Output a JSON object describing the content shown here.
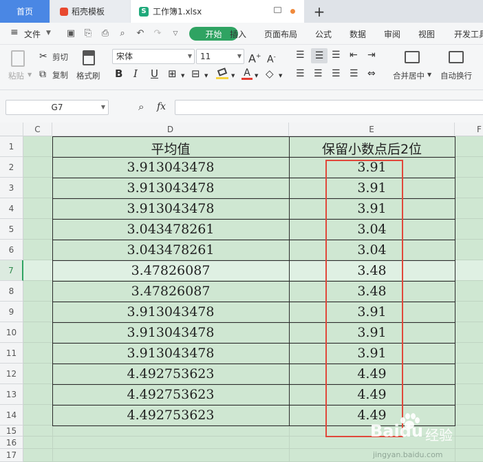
{
  "tabs": {
    "home": "首页",
    "template": "稻壳模板",
    "document": "工作簿1.xlsx",
    "doc_icon": "S"
  },
  "menu": {
    "file": "文件",
    "active": "开始",
    "items": [
      "插入",
      "页面布局",
      "公式",
      "数据",
      "审阅",
      "视图",
      "开发工具"
    ]
  },
  "ribbon": {
    "paste": "粘贴",
    "cut": "剪切",
    "copy": "复制",
    "format_painter": "格式刷",
    "font_name": "宋体",
    "font_size": "11",
    "bold": "B",
    "italic": "I",
    "underline": "U",
    "merge_center": "合并居中",
    "wrap_text": "自动换行"
  },
  "formula_bar": {
    "cell_ref": "G7",
    "fx": "fx",
    "formula": ""
  },
  "sheet": {
    "columns": [
      "C",
      "D",
      "E",
      "F"
    ],
    "rows": [
      "1",
      "2",
      "3",
      "4",
      "5",
      "6",
      "7",
      "8",
      "9",
      "10",
      "11",
      "12",
      "13",
      "14",
      "15",
      "16",
      "17"
    ],
    "selected_row": "7",
    "header_d": "平均值",
    "header_e": "保留小数点后2位",
    "d_values": [
      "3.913043478",
      "3.913043478",
      "3.913043478",
      "3.043478261",
      "3.043478261",
      "3.47826087",
      "3.47826087",
      "3.913043478",
      "3.913043478",
      "3.913043478",
      "4.492753623",
      "4.492753623",
      "4.492753623"
    ],
    "e_values": [
      "3.91",
      "3.91",
      "3.91",
      "3.04",
      "3.04",
      "3.48",
      "3.48",
      "3.91",
      "3.91",
      "3.91",
      "4.49",
      "4.49",
      "4.49"
    ]
  },
  "watermark": {
    "brand": "Baidu",
    "suffix": "经验",
    "url": "jingyan.baidu.com"
  },
  "colors": {
    "accent": "#2fa362",
    "sheet_bg": "#cfe7d2",
    "highlight_box": "#e0473a",
    "home_tab": "#4a87e4"
  }
}
